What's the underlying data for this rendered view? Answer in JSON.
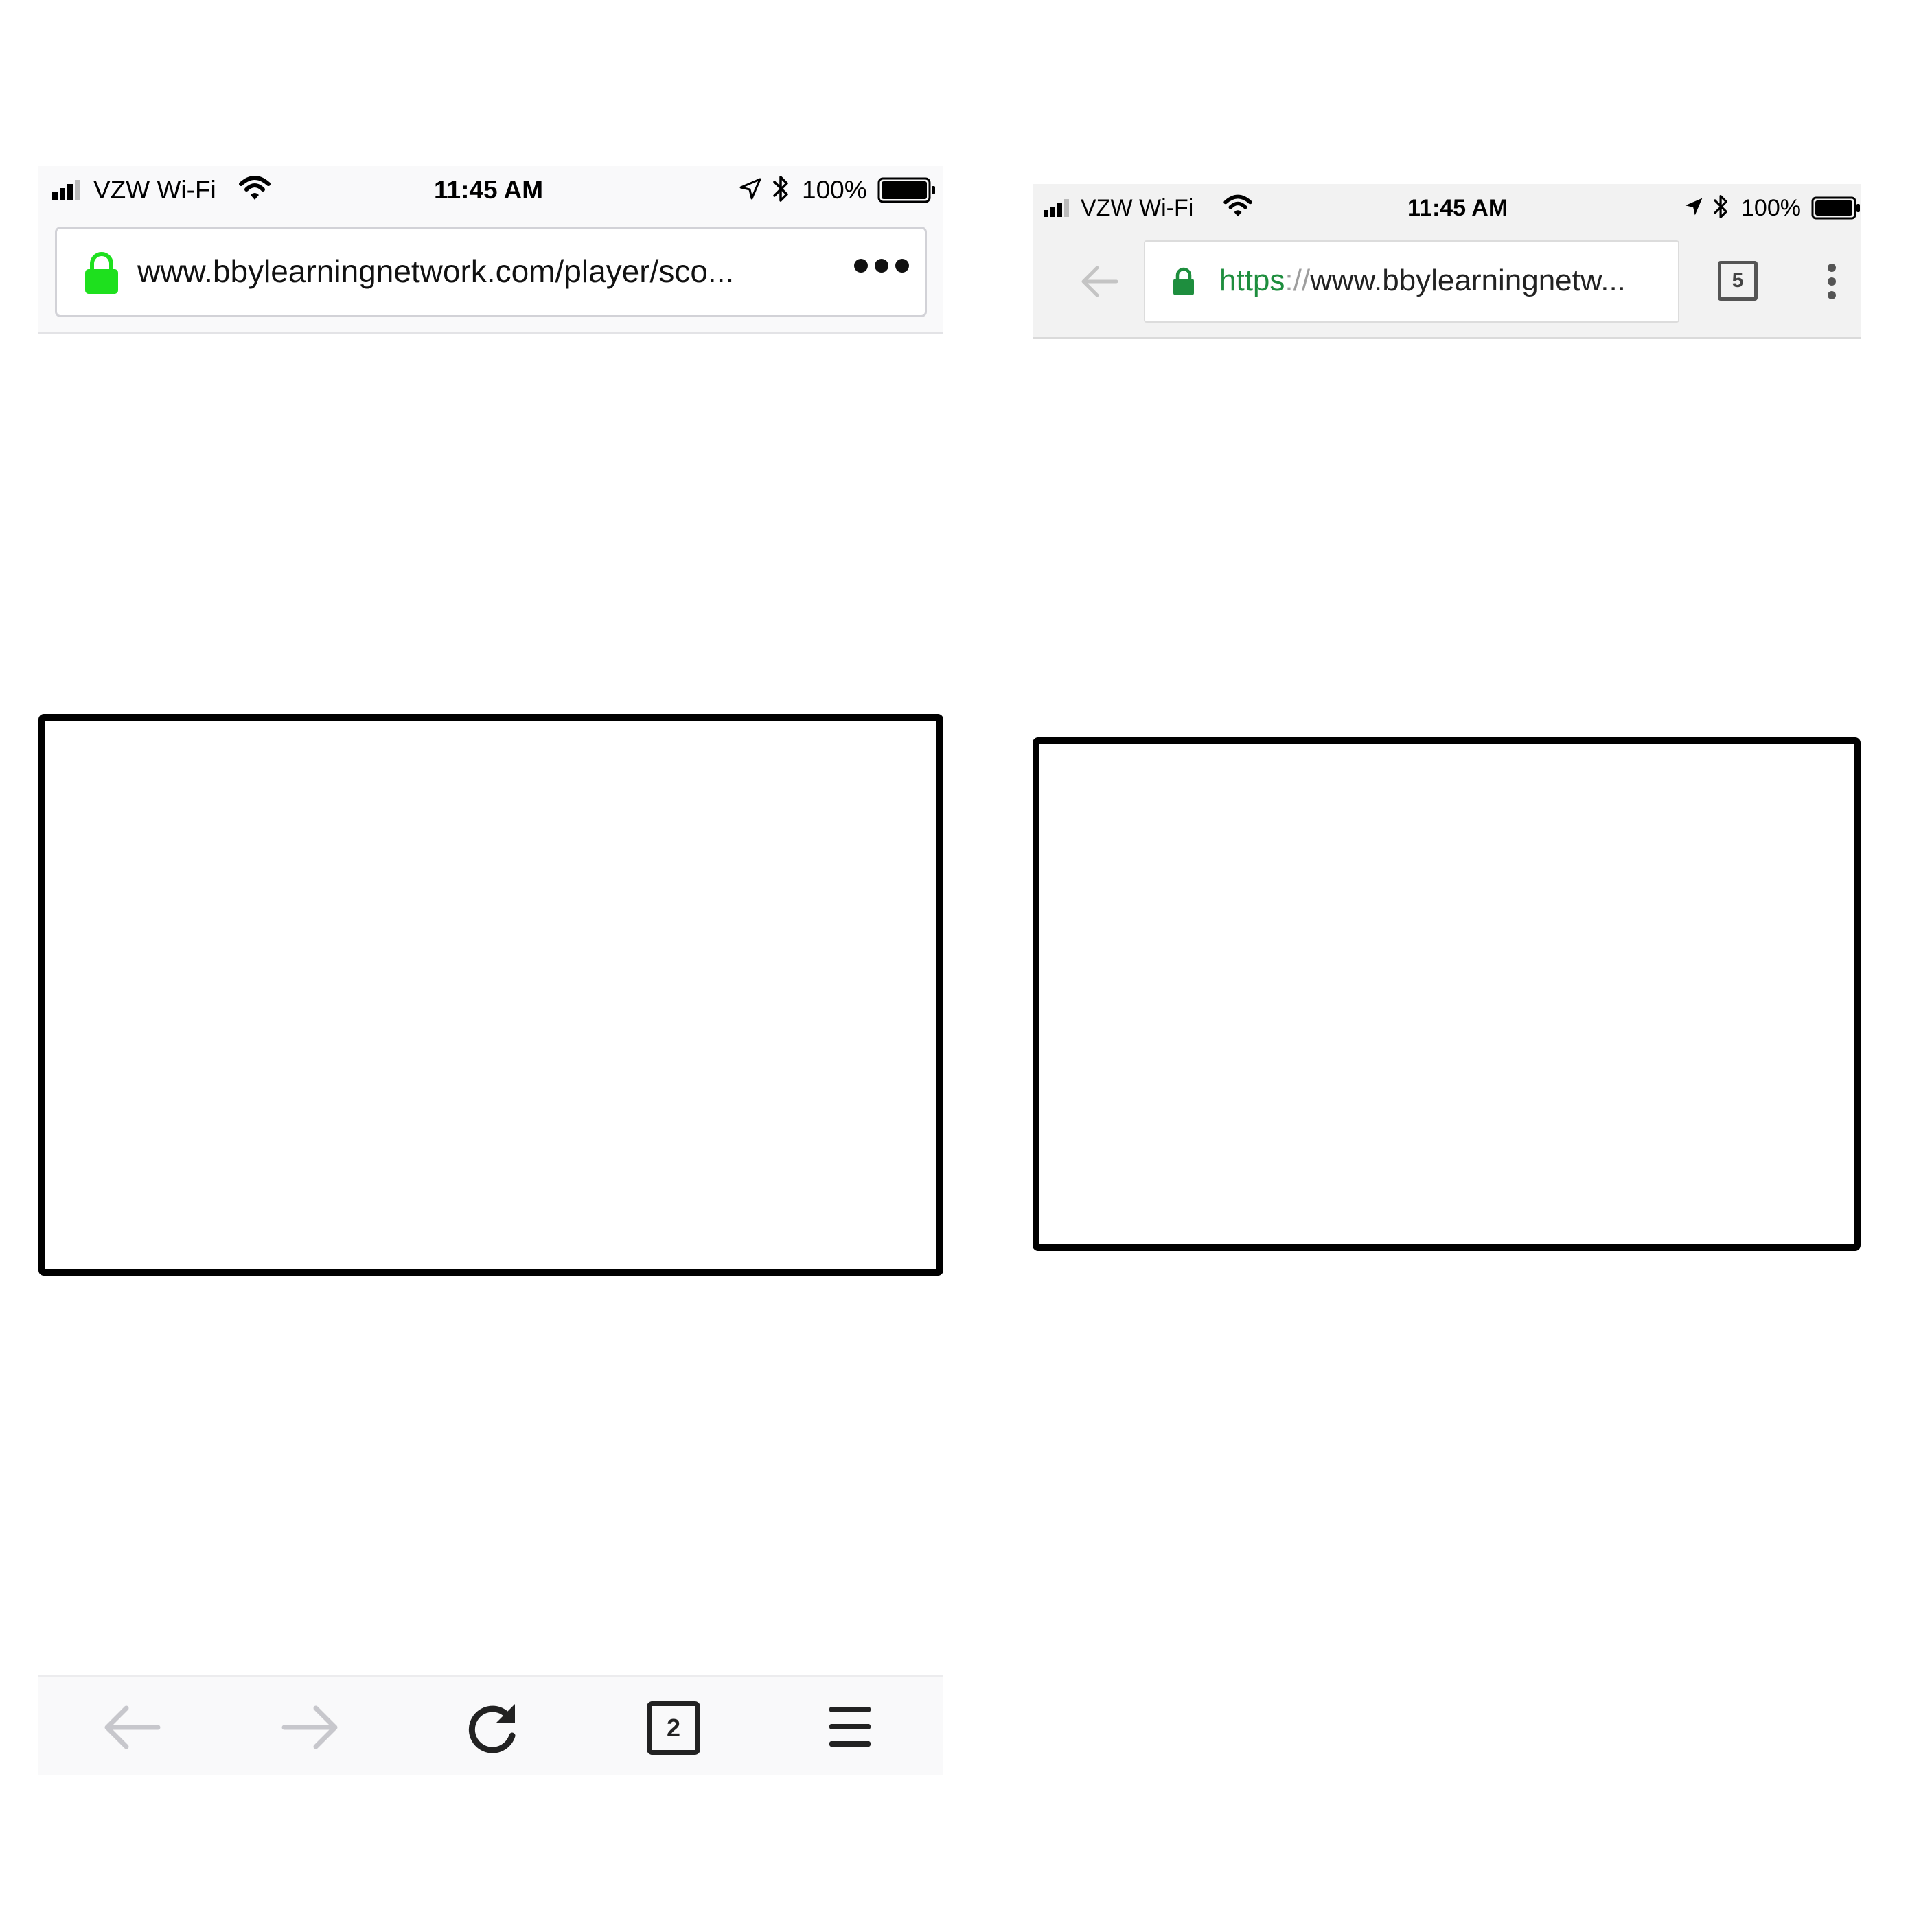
{
  "left_browser": {
    "status_bar": {
      "carrier": "VZW Wi-Fi",
      "time": "11:45 AM",
      "battery": "100%"
    },
    "address_bar": {
      "url": "www.bbylearningnetwork.com/player/sco..."
    },
    "toolbar": {
      "tab_count": "2"
    },
    "colors": {
      "lock": "#1ee01e",
      "toolbar_bg": "#f9f9fa"
    }
  },
  "right_browser": {
    "status_bar": {
      "carrier": "VZW Wi-Fi",
      "time": "11:45 AM",
      "battery": "100%"
    },
    "address_bar": {
      "url_scheme": "https",
      "url_separator": "://",
      "url_rest": "www.bbylearningnetw..."
    },
    "toolbar": {
      "tab_count": "5"
    },
    "colors": {
      "lock": "#1e8e3e",
      "toolbar_bg": "#f2f2f2"
    }
  }
}
